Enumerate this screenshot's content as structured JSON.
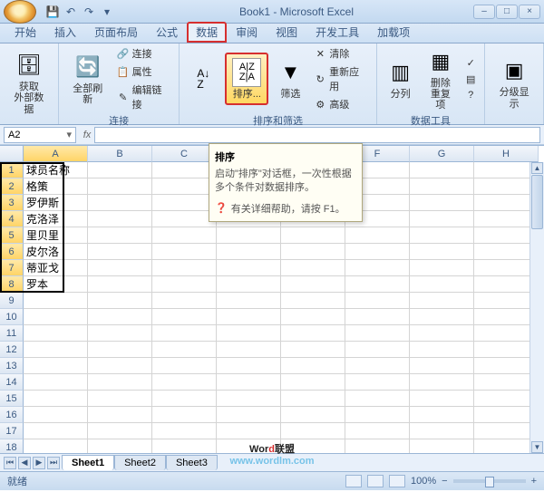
{
  "title": "Book1 - Microsoft Excel",
  "tabs": [
    "开始",
    "插入",
    "页面布局",
    "公式",
    "数据",
    "审阅",
    "视图",
    "开发工具",
    "加载项"
  ],
  "active_tab": 4,
  "ribbon": {
    "g1": {
      "btn1": "获取\n外部数据"
    },
    "g2": {
      "btn1": "全部刷新",
      "s1": "连接",
      "s2": "属性",
      "s3": "编辑链接",
      "label": "连接"
    },
    "g3": {
      "sort": "排序...",
      "filter": "筛选",
      "s1": "清除",
      "s2": "重新应用",
      "s3": "高级",
      "label": "排序和筛选"
    },
    "g4": {
      "b1": "分列",
      "b2": "删除\n重复项",
      "label": "数据工具"
    },
    "g5": {
      "b1": "分级显示"
    }
  },
  "namebox": "A2",
  "tooltip": {
    "title": "排序",
    "body": "启动\"排序\"对话框，一次性根据多个条件对数据排序。",
    "help": "有关详细帮助，请按 F1。"
  },
  "cols": [
    "A",
    "B",
    "C",
    "D",
    "E",
    "F",
    "G",
    "H"
  ],
  "rows_data": [
    "球员名称",
    "格策",
    "罗伊斯",
    "克洛泽",
    "里贝里",
    "皮尔洛",
    "蒂亚戈",
    "罗本"
  ],
  "row_count": 18,
  "sheets": [
    "Sheet1",
    "Sheet2",
    "Sheet3"
  ],
  "status": "就绪",
  "zoom": "100%",
  "zoom_minus": "−",
  "zoom_plus": "+",
  "watermark1_a": "Wor",
  "watermark1_b": "d",
  "watermark1_c": "联盟",
  "watermark2": "www.wordlm.com",
  "chart_data": null
}
